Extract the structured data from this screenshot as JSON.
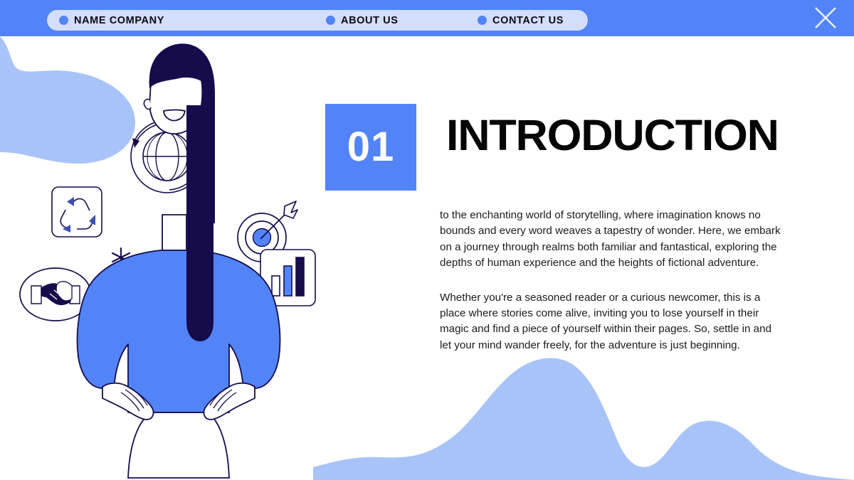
{
  "theme": {
    "brand_blue": "#5284F7",
    "pale_blue": "#A8C3F8",
    "pill_lavender": "#D3DEFC",
    "navy": "#160C4B",
    "text_dark": "#1B1B1F",
    "background": "#FFFFFF"
  },
  "navbar": {
    "items": [
      {
        "label": "NAME COMPANY",
        "icon": "dot-icon"
      },
      {
        "label": "ABOUT US",
        "icon": "dot-icon"
      },
      {
        "label": "CONTACT US",
        "icon": "dot-icon"
      }
    ],
    "close_icon": "close-icon"
  },
  "section": {
    "number": "01",
    "title": "INTRODUCTION",
    "paragraphs": [
      "to the enchanting world of storytelling, where imagination knows no bounds and every word weaves a tapestry of wonder. Here, we embark on a journey through realms both familiar and fantastical, exploring the depths of human experience and the heights of fictional adventure.",
      "Whether you're a seasoned reader or a curious newcomer, this is a place where stories come alive, inviting you to lose yourself in their magic and find a piece of yourself within their pages. So, settle in and let your mind wander freely, for the adventure is just beginning."
    ]
  },
  "illustration": {
    "icons": [
      {
        "name": "globe-rotation-icon",
        "description": "globe with circular arrows"
      },
      {
        "name": "recycle-icon",
        "description": "recycling arrows in rounded square"
      },
      {
        "name": "target-icon",
        "description": "dartboard with arrow hitting bullseye"
      },
      {
        "name": "handshake-icon",
        "description": "handshake inside ellipse"
      },
      {
        "name": "bar-chart-icon",
        "description": "ascending bar chart in rounded square"
      },
      {
        "name": "asterisk-icon",
        "description": "six-pointed sparkle"
      },
      {
        "name": "person-illustration",
        "description": "woman with long dark hair, blue sweater, hands on hips"
      }
    ]
  },
  "decorations": [
    {
      "name": "blob-top-left",
      "color": "#A8C3F8"
    },
    {
      "name": "wave-bottom-right",
      "color": "#A8C3F8"
    }
  ]
}
